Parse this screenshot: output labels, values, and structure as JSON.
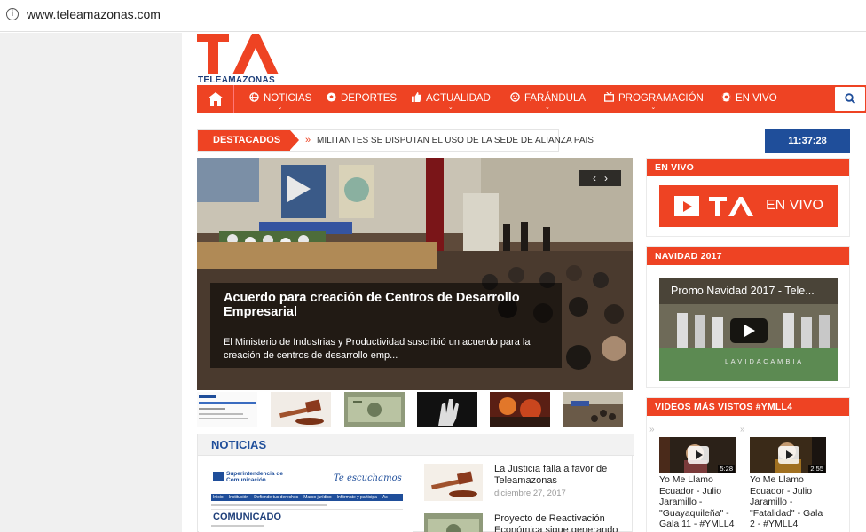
{
  "browser": {
    "url": "www.teleamazonas.com"
  },
  "logo": {
    "brand": "TELEAMAZONAS"
  },
  "nav": {
    "items": [
      {
        "label": "NOTICIAS",
        "icon": "globe-icon",
        "caret": true
      },
      {
        "label": "DEPORTES",
        "icon": "soccer-ball-icon",
        "caret": false
      },
      {
        "label": "ACTUALIDAD",
        "icon": "thumbs-up-icon",
        "caret": true
      },
      {
        "label": "FARÁNDULA",
        "icon": "smile-icon",
        "caret": true
      },
      {
        "label": "PROGRAMACIÓN",
        "icon": "tv-icon",
        "caret": true
      },
      {
        "label": "EN VIVO",
        "icon": "broadcast-icon",
        "caret": false
      }
    ]
  },
  "ticker": {
    "label": "DESTACADOS",
    "text": "MILITANTES SE DISPUTAN EL USO DE LA SEDE DE ALIANZA PAIS",
    "time": "11:37:28"
  },
  "hero": {
    "title": "Acuerdo para creación de Centros de Desarrollo Empresarial",
    "description": "El Ministerio de Industrias y Productividad suscribió un acuerdo para la creación de centros de desarrollo emp..."
  },
  "noticias": {
    "heading": "NOTICIAS",
    "card": {
      "org": "Superintendencia de Comunicación",
      "slogan": "Te escuchamos",
      "nav": [
        "Inicio",
        "Institución",
        "Defiende tus derechos",
        "Marco jurídico",
        "Infórmate y participa",
        "Ac"
      ],
      "heading": "COMUNICADO"
    },
    "items": [
      {
        "title": "La Justicia falla a favor de Teleamazonas",
        "date": "diciembre 27, 2017"
      },
      {
        "title": "Proyecto de Reactivación Económica sigue generando",
        "date": ""
      }
    ]
  },
  "sidebar": {
    "envivo": {
      "heading": "EN VIVO",
      "button_label": "EN VIVO"
    },
    "navidad": {
      "heading": "NAVIDAD 2017",
      "video_title": "Promo Navidad 2017 - Tele...",
      "video_footer": "L A   V I D A   C A M B I A"
    },
    "videos": {
      "heading": "VIDEOS MÁS VISTOS #YMLL4",
      "items": [
        {
          "caption": "Yo Me Llamo Ecuador - Julio Jaramillo - \"Guayaquileña\" - Gala 11 - #YMLL4",
          "duration": "5:28"
        },
        {
          "caption": "Yo Me Llamo Ecuador - Julio Jaramillo - \"Fatalidad\" - Gala 2 - #YMLL4",
          "duration": "2:55"
        }
      ]
    }
  },
  "colors": {
    "brand_red": "#ee4323",
    "brand_blue": "#1f4e9a"
  }
}
